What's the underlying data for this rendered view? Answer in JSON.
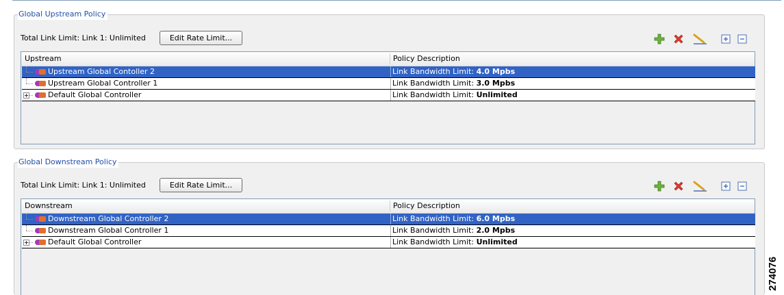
{
  "upstream": {
    "legend": "Global Upstream Policy",
    "total_link_limit": "Total Link Limit:  Link 1: Unlimited",
    "edit_button": "Edit Rate Limit...",
    "toolbar": [
      "add-icon",
      "delete-icon",
      "edit-icon",
      "expand-all-icon",
      "collapse-all-icon"
    ],
    "columns": [
      "Upstream",
      "Policy Description"
    ],
    "rows": [
      {
        "name": "Upstream Global Contoller 2",
        "desc_prefix": "Link Bandwidth Limit: ",
        "desc_value": "4.0 Mpbs",
        "selected": true,
        "expandable": false
      },
      {
        "name": "Upstream Global Controller 1",
        "desc_prefix": "Link Bandwidth Limit: ",
        "desc_value": "3.0 Mpbs",
        "selected": false,
        "expandable": false
      },
      {
        "name": "Default Global Controller",
        "desc_prefix": "Link Bandwidth Limit: ",
        "desc_value": "Unlimited",
        "selected": false,
        "expandable": true
      }
    ]
  },
  "downstream": {
    "legend": "Global Downstream Policy",
    "total_link_limit": "Total Link Limit:  Link 1: Unlimited",
    "edit_button": "Edit Rate Limit...",
    "toolbar": [
      "add-icon",
      "delete-icon",
      "edit-icon",
      "expand-all-icon",
      "collapse-all-icon"
    ],
    "columns": [
      "Downstream",
      "Policy Description"
    ],
    "rows": [
      {
        "name": "Downstream Global Controller 2",
        "desc_prefix": "Link Bandwidth Limit: ",
        "desc_value": "6.0 Mpbs",
        "selected": true,
        "expandable": false
      },
      {
        "name": "Downstream Global Controller 1",
        "desc_prefix": "Link Bandwidth Limit: ",
        "desc_value": "2.0 Mpbs",
        "selected": false,
        "expandable": false
      },
      {
        "name": "Default Global Controller",
        "desc_prefix": "Link Bandwidth Limit: ",
        "desc_value": "Unlimited",
        "selected": false,
        "expandable": true
      }
    ]
  },
  "figure_number": "274076",
  "colors": {
    "selection": "#3163c5",
    "legend_text": "#1f4ea5",
    "panel_bg": "#f0f0f0"
  }
}
